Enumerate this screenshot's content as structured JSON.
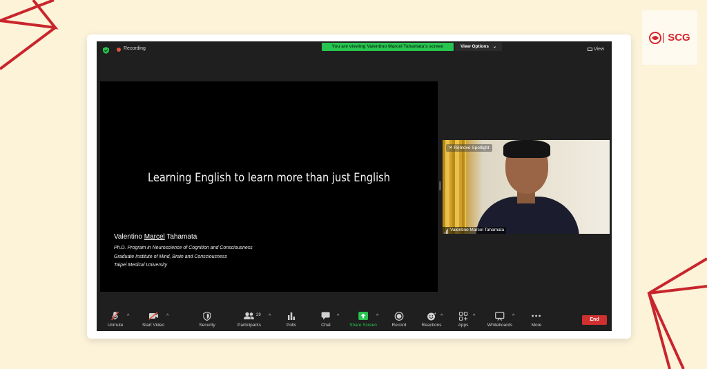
{
  "brand": {
    "logo_text": "SCG",
    "brand_color": "#d8262f"
  },
  "background": {
    "color": "#fcf3d9",
    "accent": "#c9252c"
  },
  "topbar": {
    "recording_label": "Recording",
    "viewing_banner": "You are viewing Valentino Marcel Tahamata's screen",
    "view_options_label": "View Options",
    "view_label": "View"
  },
  "slide": {
    "title": "Learning English to learn more than just English",
    "author_first": "Valentino ",
    "author_middle": "Marcel",
    "author_last": " Tahamata",
    "line1": "Ph.D. Program in Neuroscience of Cognition and Consciousness",
    "line2": "Graduate Institute of Mind, Brain and Consciousness",
    "line3": "Taipei Medical University"
  },
  "video": {
    "remove_spotlight_label": "Remove Spotlight",
    "participant_name": "Valentino Marcel Tahamata"
  },
  "toolbar": {
    "unmute": "Unmute",
    "start_video": "Start Video",
    "security": "Security",
    "participants": "Participants",
    "participants_count": "29",
    "polls": "Polls",
    "chat": "Chat",
    "share_screen": "Share Screen",
    "record": "Record",
    "reactions": "Reactions",
    "apps": "Apps",
    "whiteboards": "Whiteboards",
    "more": "More",
    "end": "End"
  },
  "colors": {
    "zoom_bg": "#1f1f1f",
    "share_green": "#27c44f",
    "end_red": "#d0302f"
  }
}
